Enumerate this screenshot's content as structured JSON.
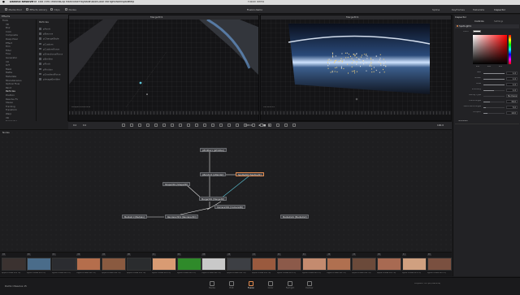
{
  "menubar": {
    "items": [
      "DaVinci Resolve",
      "File",
      "Edit",
      "Trim",
      "Timeline",
      "Clip",
      "Mark",
      "View",
      "Playback",
      "Fusion",
      "Color",
      "Fairlight",
      "Workspace",
      "Help"
    ],
    "project_title": "Fusion demo"
  },
  "toolbar": {
    "left": [
      "Media Pool",
      "Effects Library",
      "Clips",
      "Nodes"
    ],
    "center": "Fusion demo",
    "right": [
      "Spline",
      "Keyframes",
      "Metadata",
      "Inspector"
    ]
  },
  "effects": {
    "header": "Effects",
    "tree": [
      "Tools",
      "3D",
      "Blur",
      "Color",
      "Composite",
      "Deep Pixel",
      "Effect",
      "Film",
      "Filter",
      "Flow",
      "Generator",
      "I/O",
      "LUT",
      "Mask",
      "Matte",
      "Metadata",
      "Miscellaneous",
      "Optical Flow",
      "Paint",
      "Particles",
      "Position",
      "Resolve Fx",
      "Stereo",
      "Tracking",
      "Transform",
      "Warp",
      "VR",
      "Templates"
    ],
    "selected_index": 19,
    "tools_header": "Particles",
    "tools": [
      "pAvoid",
      "pBounce",
      "pChangeStyle",
      "pCustom",
      "pCustomForce",
      "pDirectionalForce",
      "pEmitter",
      "pFlock",
      "pFriction",
      "pGradientForce",
      "pImageEmitter"
    ]
  },
  "viewer_left": {
    "title": "Merge3D1",
    "caption": "PerspectiveCamera"
  },
  "viewer_right": {
    "title": "Merge3D1",
    "caption": "Camera3D1"
  },
  "transport": {
    "left_field": "0.0",
    "right_field": "100.0",
    "timecode_mid": "103.0"
  },
  "nodes": [
    {
      "label": "pEmitter1 [pEmitter]",
      "selected": false
    },
    {
      "label": "pRender1 [pRender]",
      "selected": false
    },
    {
      "label": "Spotlight1 [SpotLight]",
      "selected": true
    },
    {
      "label": "Shape3D1 [Shape3D]",
      "selected": false
    },
    {
      "label": "Merge3D1 [Merge3D]",
      "selected": false
    },
    {
      "label": "Renderer3D1 [Renderer3D]",
      "selected": false
    },
    {
      "label": "Camera3D1 [Camera3D]",
      "selected": false
    },
    {
      "label": "MediaIn1 [MediaIn]",
      "selected": false
    },
    {
      "label": "MediaOut1 [MediaOut]",
      "selected": false
    }
  ],
  "nodes_header": "Nodes",
  "inspector": {
    "title": "Inspector",
    "tab_controls": "Controls",
    "tab_settings": "Settings",
    "tool": "SpotLight1",
    "color_label": "Color",
    "color_values": [
      "1.0",
      "1.0",
      "1.0"
    ],
    "props": [
      {
        "label": "Red",
        "value": "1.0",
        "level": 1.0
      },
      {
        "label": "Green",
        "value": "1.0",
        "level": 1.0
      },
      {
        "label": "Blue",
        "value": "1.0",
        "level": 1.0
      },
      {
        "label": "Intensity",
        "value": "1.0",
        "level": 0.5
      },
      {
        "label": "Decay Type",
        "value": "No Decay",
        "level": 0
      },
      {
        "label": "Cone Angle",
        "value": "30.0",
        "level": 0.3
      },
      {
        "label": "Penumbra Angle",
        "value": "5.0",
        "level": 0.1
      },
      {
        "label": "Dropoff",
        "value": "10.0",
        "level": 0.2
      }
    ],
    "shadows_label": "Shadows",
    "transform_label": "Transform"
  },
  "clips": [
    {
      "num": "01",
      "name": "Apple ProRes 422 HQ"
    },
    {
      "num": "02",
      "name": "Apple ProRes 422 HQ"
    },
    {
      "num": "03",
      "name": "Apple ProRes 422 HQ"
    },
    {
      "num": "04",
      "name": "Apple ProRes 422 HQ"
    },
    {
      "num": "05",
      "name": "Apple ProRes 422 HQ"
    },
    {
      "num": "06",
      "name": "Apple ProRes 422 HQ"
    },
    {
      "num": "07",
      "name": "Apple ProRes 422 HQ"
    },
    {
      "num": "08",
      "name": "Apple ProRes 422 HQ"
    },
    {
      "num": "09",
      "name": "Apple ProRes 422 HQ"
    },
    {
      "num": "10",
      "name": "Apple ProRes 422 HQ"
    },
    {
      "num": "11",
      "name": "Apple ProRes 422 HQ"
    },
    {
      "num": "12",
      "name": "Apple ProRes 422 HQ"
    },
    {
      "num": "13",
      "name": "Apple ProRes 422 HQ"
    },
    {
      "num": "14",
      "name": "Apple ProRes 422 HQ"
    },
    {
      "num": "15",
      "name": "Apple ProRes 422 HQ"
    },
    {
      "num": "16",
      "name": "Apple ProRes 422 HQ"
    },
    {
      "num": "17",
      "name": "Apple ProRes 422 HQ"
    },
    {
      "num": "18",
      "name": "Apple ProRes 422 HQ"
    }
  ],
  "clip_colors": [
    "#3b3230",
    "#4a6c8a",
    "#2b2c30",
    "#b56e4c",
    "#8a5a40",
    "#2a2c2e",
    "#d99b73",
    "#2f8a2a",
    "#c9c9c9",
    "#3d3f44",
    "#9a5a3e",
    "#8c5a4a",
    "#c48b6f",
    "#b07050",
    "#6b4a3a",
    "#a86a52",
    "#d0a080",
    "#7a5040"
  ],
  "pagebar": {
    "brand": "DaVinci Resolve 15",
    "pages": [
      "Media",
      "Edit",
      "Fusion",
      "Color",
      "Fairlight",
      "Deliver"
    ],
    "active_index": 2,
    "status": "Playback: 24 fps (realtime)"
  },
  "colors": {
    "accent": "#e38b4f",
    "bg": "#1b1b1d",
    "node_link": "#5ec6d8"
  }
}
